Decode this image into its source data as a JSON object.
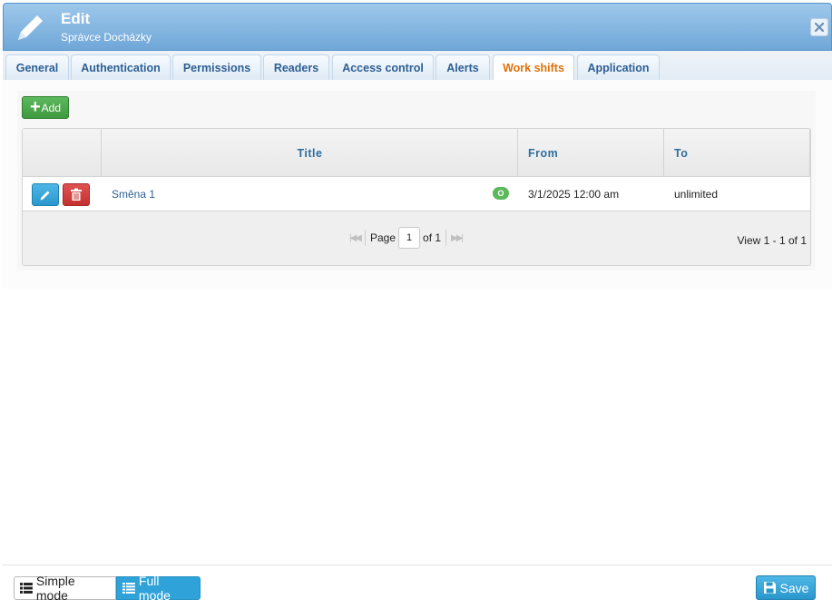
{
  "header": {
    "title": "Edit",
    "subtitle": "Správce Docházky"
  },
  "tabs": [
    {
      "label": "General"
    },
    {
      "label": "Authentication"
    },
    {
      "label": "Permissions"
    },
    {
      "label": "Readers"
    },
    {
      "label": "Access control"
    },
    {
      "label": "Alerts"
    },
    {
      "label": "Work shifts",
      "active": true
    },
    {
      "label": "Application"
    }
  ],
  "toolbar": {
    "add_label": "Add"
  },
  "grid": {
    "columns": [
      "",
      "Title",
      "From",
      "To"
    ],
    "rows": [
      {
        "title": "Směna 1",
        "badge": "O",
        "from": "3/1/2025 12:00 am",
        "to": "unlimited"
      }
    ],
    "pager": {
      "page_label": "Page",
      "page_value": "1",
      "of_label": "of 1",
      "view_info": "View 1 - 1 of 1"
    }
  },
  "footer": {
    "simple_mode": "Simple mode",
    "full_mode": "Full mode",
    "save": "Save"
  },
  "colors": {
    "header": "#6fa7d8",
    "active_tab": "#e17009",
    "add": "#3f9a3f",
    "edit": "#2a97cc",
    "delete": "#c53030",
    "full_mode": "#2fa3d9"
  },
  "icons": [
    "pencil-icon",
    "close-icon",
    "plus-icon",
    "edit-icon",
    "trash-icon",
    "list-icon",
    "save-icon"
  ]
}
